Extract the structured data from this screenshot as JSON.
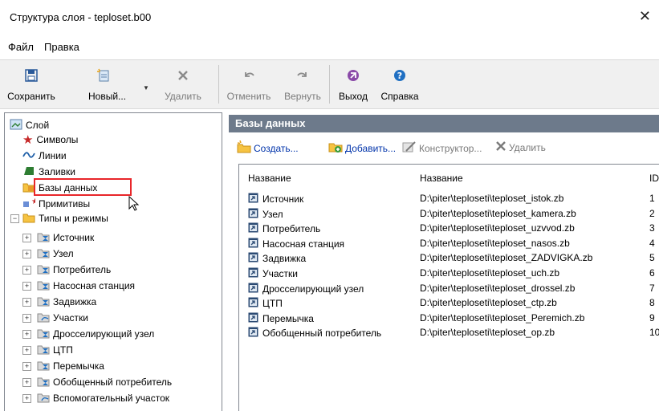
{
  "window": {
    "title": "Структура слоя - teploset.b00"
  },
  "menu": [
    {
      "label": "Файл"
    },
    {
      "label": "Правка"
    }
  ],
  "toolbar": {
    "save": "Сохранить",
    "new": "Новый...",
    "delete": "Удалить",
    "undo": "Отменить",
    "redo": "Вернуть",
    "exit": "Выход",
    "help": "Справка"
  },
  "tree": {
    "root": "Слой",
    "items": [
      {
        "label": "Символы"
      },
      {
        "label": "Линии"
      },
      {
        "label": "Заливки"
      },
      {
        "label": "Базы данных"
      },
      {
        "label": "Примитивы"
      }
    ],
    "types": {
      "label": "Типы и режимы",
      "children": [
        {
          "label": "Источник"
        },
        {
          "label": "Узел"
        },
        {
          "label": "Потребитель"
        },
        {
          "label": "Насосная станция"
        },
        {
          "label": "Задвижка"
        },
        {
          "label": "Участки"
        },
        {
          "label": "Дросселирующий узел"
        },
        {
          "label": "ЦТП"
        },
        {
          "label": "Перемычка"
        },
        {
          "label": "Обобщенный потребитель"
        },
        {
          "label": "Вспомогательный участок"
        }
      ]
    }
  },
  "panel": {
    "title": "Базы данных",
    "actions": {
      "create": "Создать...",
      "add": "Добавить...",
      "constructor": "Конструктор...",
      "delete": "Удалить"
    },
    "columns": [
      "Название",
      "Название",
      "ID"
    ],
    "rows": [
      {
        "name": "Источник",
        "path": "D:\\piter\\teploseti\\teploset_istok.zb",
        "id": "1"
      },
      {
        "name": "Узел",
        "path": "D:\\piter\\teploseti\\teploset_kamera.zb",
        "id": "2"
      },
      {
        "name": "Потребитель",
        "path": "D:\\piter\\teploseti\\teploset_uzvvod.zb",
        "id": "3"
      },
      {
        "name": "Насосная станция",
        "path": "D:\\piter\\teploseti\\teploset_nasos.zb",
        "id": "4"
      },
      {
        "name": "Задвижка",
        "path": "D:\\piter\\teploseti\\teploset_ZADVIGKA.zb",
        "id": "5"
      },
      {
        "name": "Участки",
        "path": "D:\\piter\\teploseti\\teploset_uch.zb",
        "id": "6"
      },
      {
        "name": "Дросселирующий узел",
        "path": "D:\\piter\\teploseti\\teploset_drossel.zb",
        "id": "7"
      },
      {
        "name": "ЦТП",
        "path": "D:\\piter\\teploseti\\teploset_ctp.zb",
        "id": "8"
      },
      {
        "name": "Перемычка",
        "path": "D:\\piter\\teploseti\\teploset_Peremich.zb",
        "id": "9"
      },
      {
        "name": "Обобщенный потребитель",
        "path": "D:\\piter\\teploseti\\teploset_op.zb",
        "id": "10"
      }
    ]
  },
  "colors": {
    "panel_header": "#6d7a8b",
    "highlight": "#e8262a",
    "link": "#0033aa"
  }
}
